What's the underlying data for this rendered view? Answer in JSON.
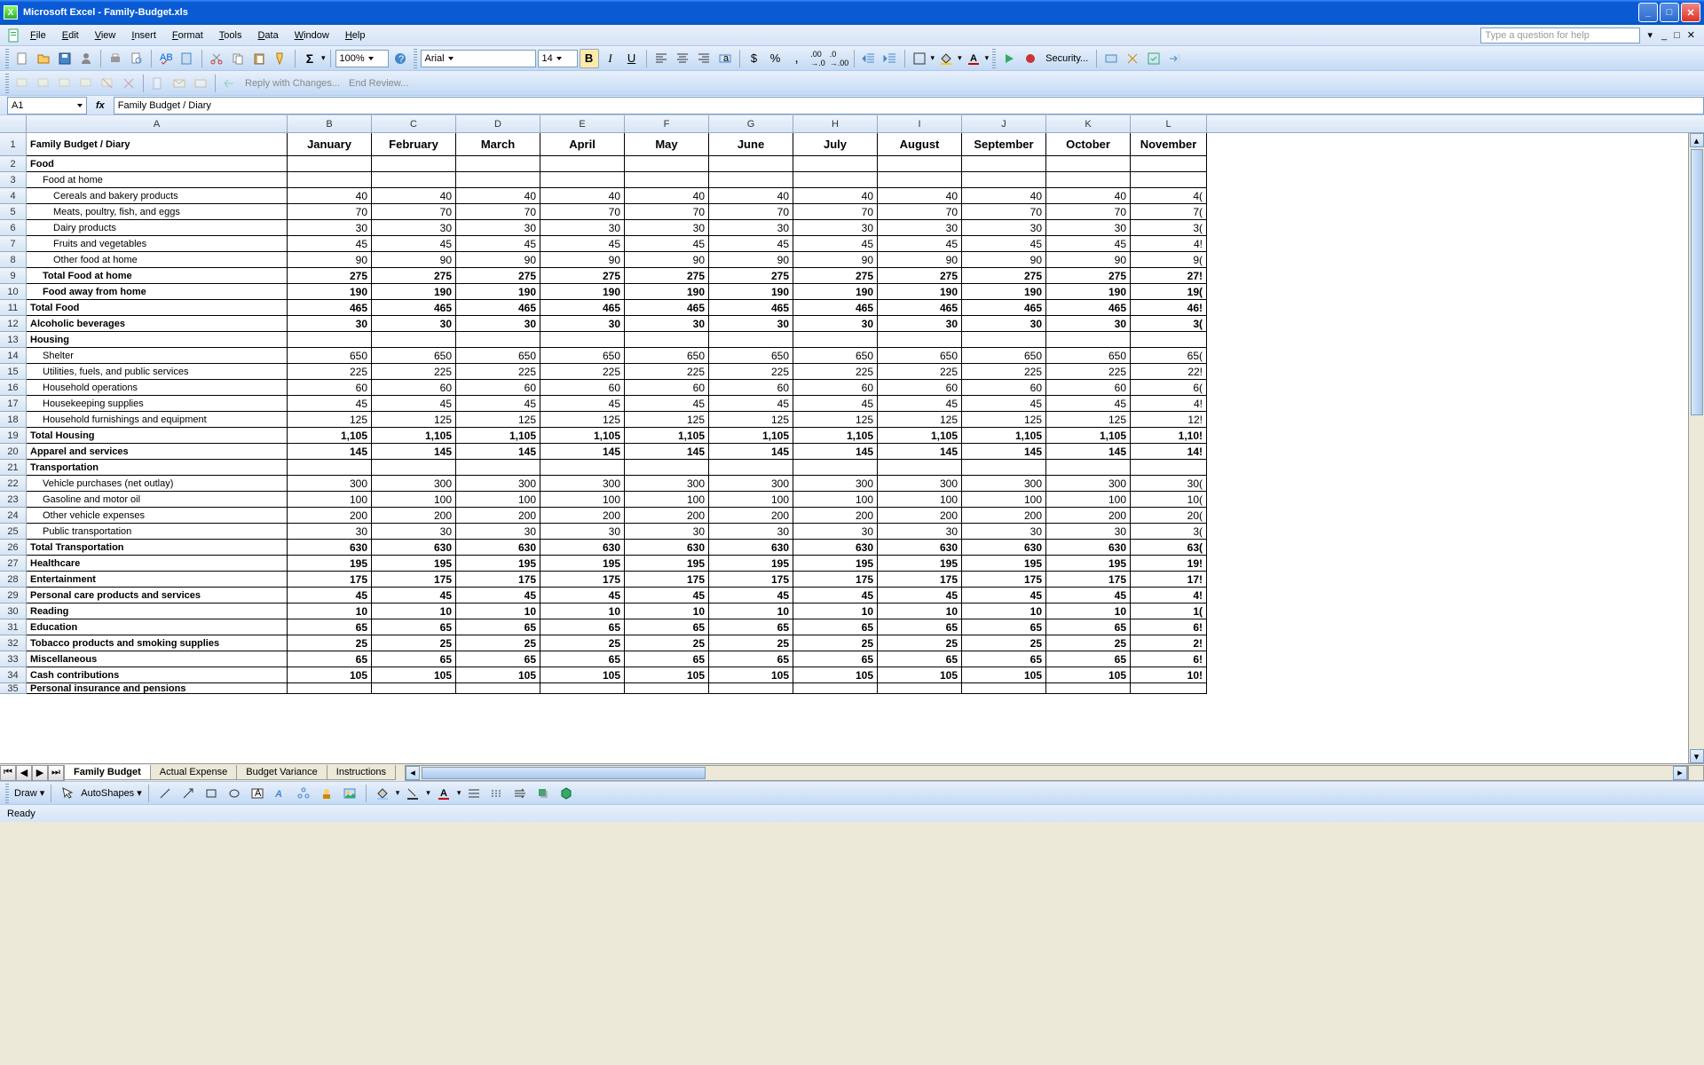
{
  "app": {
    "title": "Microsoft Excel - Family-Budget.xls"
  },
  "menu": {
    "items": [
      "File",
      "Edit",
      "View",
      "Insert",
      "Format",
      "Tools",
      "Data",
      "Window",
      "Help"
    ],
    "helpPlaceholder": "Type a question for help"
  },
  "toolbar": {
    "zoom": "100%",
    "font": "Arial",
    "size": "14",
    "security": "Security..."
  },
  "reviewbar": {
    "reply": "Reply with Changes...",
    "end": "End Review..."
  },
  "fbar": {
    "name": "A1",
    "formula": "Family Budget / Diary"
  },
  "columns": [
    "A",
    "B",
    "C",
    "D",
    "E",
    "F",
    "G",
    "H",
    "I",
    "J",
    "K",
    "L"
  ],
  "months": [
    "January",
    "February",
    "March",
    "April",
    "May",
    "June",
    "July",
    "August",
    "September",
    "October",
    "November"
  ],
  "rows": [
    {
      "n": 1,
      "label": "Family Budget / Diary",
      "style": "title",
      "bold": true,
      "vals": null,
      "hdr": true
    },
    {
      "n": 2,
      "label": "Food",
      "bold": true,
      "vals": []
    },
    {
      "n": 3,
      "label": "Food at home",
      "indent": 1,
      "vals": []
    },
    {
      "n": 4,
      "label": "Cereals and bakery products",
      "indent": 2,
      "vals": [
        40,
        40,
        40,
        40,
        40,
        40,
        40,
        40,
        40,
        40,
        "4("
      ]
    },
    {
      "n": 5,
      "label": "Meats, poultry, fish, and eggs",
      "indent": 2,
      "vals": [
        70,
        70,
        70,
        70,
        70,
        70,
        70,
        70,
        70,
        70,
        "7("
      ]
    },
    {
      "n": 6,
      "label": "Dairy products",
      "indent": 2,
      "vals": [
        30,
        30,
        30,
        30,
        30,
        30,
        30,
        30,
        30,
        30,
        "3("
      ]
    },
    {
      "n": 7,
      "label": "Fruits and vegetables",
      "indent": 2,
      "vals": [
        45,
        45,
        45,
        45,
        45,
        45,
        45,
        45,
        45,
        45,
        "4!"
      ]
    },
    {
      "n": 8,
      "label": "Other food at home",
      "indent": 2,
      "vals": [
        90,
        90,
        90,
        90,
        90,
        90,
        90,
        90,
        90,
        90,
        "9("
      ]
    },
    {
      "n": 9,
      "label": "Total Food at home",
      "bold": true,
      "indent": 1,
      "vals": [
        275,
        275,
        275,
        275,
        275,
        275,
        275,
        275,
        275,
        275,
        "27!"
      ]
    },
    {
      "n": 10,
      "label": "Food away from home",
      "bold": true,
      "indent": 1,
      "vals": [
        190,
        190,
        190,
        190,
        190,
        190,
        190,
        190,
        190,
        190,
        "19("
      ]
    },
    {
      "n": 11,
      "label": "Total Food",
      "bold": true,
      "vals": [
        465,
        465,
        465,
        465,
        465,
        465,
        465,
        465,
        465,
        465,
        "46!"
      ]
    },
    {
      "n": 12,
      "label": "Alcoholic beverages",
      "bold": true,
      "vals": [
        30,
        30,
        30,
        30,
        30,
        30,
        30,
        30,
        30,
        30,
        "3("
      ]
    },
    {
      "n": 13,
      "label": "Housing",
      "bold": true,
      "vals": []
    },
    {
      "n": 14,
      "label": "Shelter",
      "indent": 1,
      "vals": [
        650,
        650,
        650,
        650,
        650,
        650,
        650,
        650,
        650,
        650,
        "65("
      ]
    },
    {
      "n": 15,
      "label": "Utilities, fuels, and public services",
      "indent": 1,
      "vals": [
        225,
        225,
        225,
        225,
        225,
        225,
        225,
        225,
        225,
        225,
        "22!"
      ]
    },
    {
      "n": 16,
      "label": "Household operations",
      "indent": 1,
      "vals": [
        60,
        60,
        60,
        60,
        60,
        60,
        60,
        60,
        60,
        60,
        "6("
      ]
    },
    {
      "n": 17,
      "label": "Housekeeping supplies",
      "indent": 1,
      "vals": [
        45,
        45,
        45,
        45,
        45,
        45,
        45,
        45,
        45,
        45,
        "4!"
      ]
    },
    {
      "n": 18,
      "label": "Household furnishings and equipment",
      "indent": 1,
      "vals": [
        125,
        125,
        125,
        125,
        125,
        125,
        125,
        125,
        125,
        125,
        "12!"
      ]
    },
    {
      "n": 19,
      "label": "Total Housing",
      "bold": true,
      "vals": [
        "1,105",
        "1,105",
        "1,105",
        "1,105",
        "1,105",
        "1,105",
        "1,105",
        "1,105",
        "1,105",
        "1,105",
        "1,10!"
      ]
    },
    {
      "n": 20,
      "label": "Apparel and services",
      "bold": true,
      "vals": [
        145,
        145,
        145,
        145,
        145,
        145,
        145,
        145,
        145,
        145,
        "14!"
      ]
    },
    {
      "n": 21,
      "label": "Transportation",
      "bold": true,
      "vals": []
    },
    {
      "n": 22,
      "label": "Vehicle purchases (net outlay)",
      "indent": 1,
      "vals": [
        300,
        300,
        300,
        300,
        300,
        300,
        300,
        300,
        300,
        300,
        "30("
      ]
    },
    {
      "n": 23,
      "label": "Gasoline and motor oil",
      "indent": 1,
      "vals": [
        100,
        100,
        100,
        100,
        100,
        100,
        100,
        100,
        100,
        100,
        "10("
      ]
    },
    {
      "n": 24,
      "label": "Other vehicle expenses",
      "indent": 1,
      "vals": [
        200,
        200,
        200,
        200,
        200,
        200,
        200,
        200,
        200,
        200,
        "20("
      ]
    },
    {
      "n": 25,
      "label": "Public transportation",
      "indent": 1,
      "vals": [
        30,
        30,
        30,
        30,
        30,
        30,
        30,
        30,
        30,
        30,
        "3("
      ]
    },
    {
      "n": 26,
      "label": "Total Transportation",
      "bold": true,
      "vals": [
        630,
        630,
        630,
        630,
        630,
        630,
        630,
        630,
        630,
        630,
        "63("
      ]
    },
    {
      "n": 27,
      "label": "Healthcare",
      "bold": true,
      "vals": [
        195,
        195,
        195,
        195,
        195,
        195,
        195,
        195,
        195,
        195,
        "19!"
      ]
    },
    {
      "n": 28,
      "label": "Entertainment",
      "bold": true,
      "vals": [
        175,
        175,
        175,
        175,
        175,
        175,
        175,
        175,
        175,
        175,
        "17!"
      ]
    },
    {
      "n": 29,
      "label": "Personal care products and services",
      "bold": true,
      "vals": [
        45,
        45,
        45,
        45,
        45,
        45,
        45,
        45,
        45,
        45,
        "4!"
      ]
    },
    {
      "n": 30,
      "label": "Reading",
      "bold": true,
      "vals": [
        10,
        10,
        10,
        10,
        10,
        10,
        10,
        10,
        10,
        10,
        "1("
      ]
    },
    {
      "n": 31,
      "label": "Education",
      "bold": true,
      "vals": [
        65,
        65,
        65,
        65,
        65,
        65,
        65,
        65,
        65,
        65,
        "6!"
      ]
    },
    {
      "n": 32,
      "label": "Tobacco products and smoking supplies",
      "bold": true,
      "vals": [
        25,
        25,
        25,
        25,
        25,
        25,
        25,
        25,
        25,
        25,
        "2!"
      ]
    },
    {
      "n": 33,
      "label": "Miscellaneous",
      "bold": true,
      "vals": [
        65,
        65,
        65,
        65,
        65,
        65,
        65,
        65,
        65,
        65,
        "6!"
      ]
    },
    {
      "n": 34,
      "label": "Cash contributions",
      "bold": true,
      "vals": [
        105,
        105,
        105,
        105,
        105,
        105,
        105,
        105,
        105,
        105,
        "10!"
      ]
    },
    {
      "n": 35,
      "label": "Personal insurance and pensions",
      "bold": true,
      "vals": [],
      "partial": true
    }
  ],
  "tabs": [
    "Family Budget",
    "Actual Expense",
    "Budget Variance",
    "Instructions"
  ],
  "drawbar": {
    "draw": "Draw",
    "autoshapes": "AutoShapes"
  },
  "status": "Ready"
}
